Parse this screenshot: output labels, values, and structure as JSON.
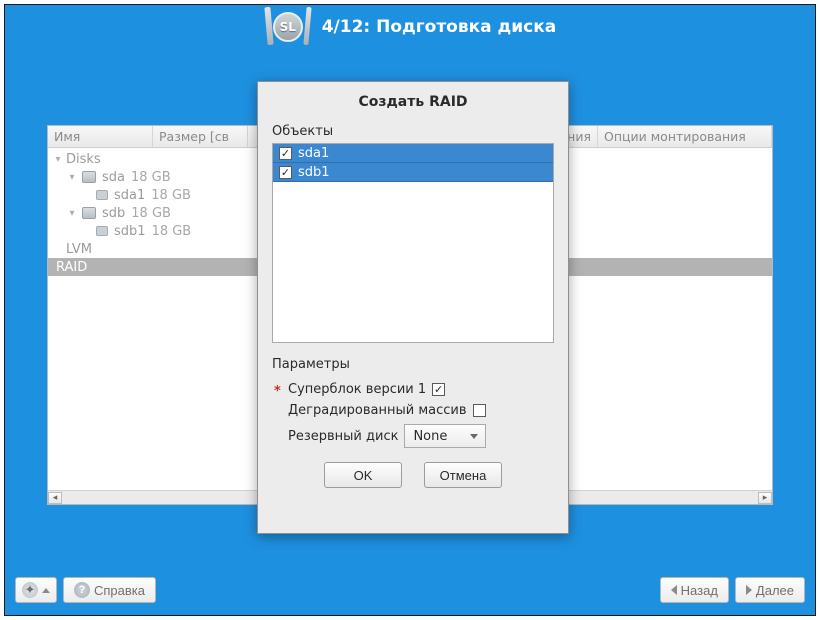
{
  "header": {
    "badge_text": "SL",
    "title": "4/12: Подготовка диска"
  },
  "columns": {
    "name": "Имя",
    "size": "Размер [св",
    "fs": "",
    "mount_tail": "ния",
    "options": "Опции монтирования"
  },
  "tree": {
    "disks_label": "Disks",
    "items": [
      {
        "name": "sda",
        "size": "18 GB",
        "children": [
          {
            "name": "sda1",
            "size": "18 GB"
          }
        ]
      },
      {
        "name": "sdb",
        "size": "18 GB",
        "children": [
          {
            "name": "sdb1",
            "size": "18 GB"
          }
        ]
      }
    ],
    "lvm_label": "LVM",
    "raid_label": "RAID"
  },
  "dialog": {
    "title": "Создать RAID",
    "objects_label": "Объекты",
    "objects": [
      {
        "name": "sda1",
        "checked": true
      },
      {
        "name": "sdb1",
        "checked": true
      }
    ],
    "params_label": "Параметры",
    "superblock_label": "Суперблок версии 1",
    "superblock_checked": true,
    "degraded_label": "Деградированный массив",
    "degraded_checked": false,
    "spare_label": "Резервный диск",
    "spare_value": "None",
    "ok_label": "OK",
    "cancel_label": "Отмена"
  },
  "footer": {
    "help_label": "Справка",
    "back_label": "Назад",
    "next_label": "Далее"
  }
}
